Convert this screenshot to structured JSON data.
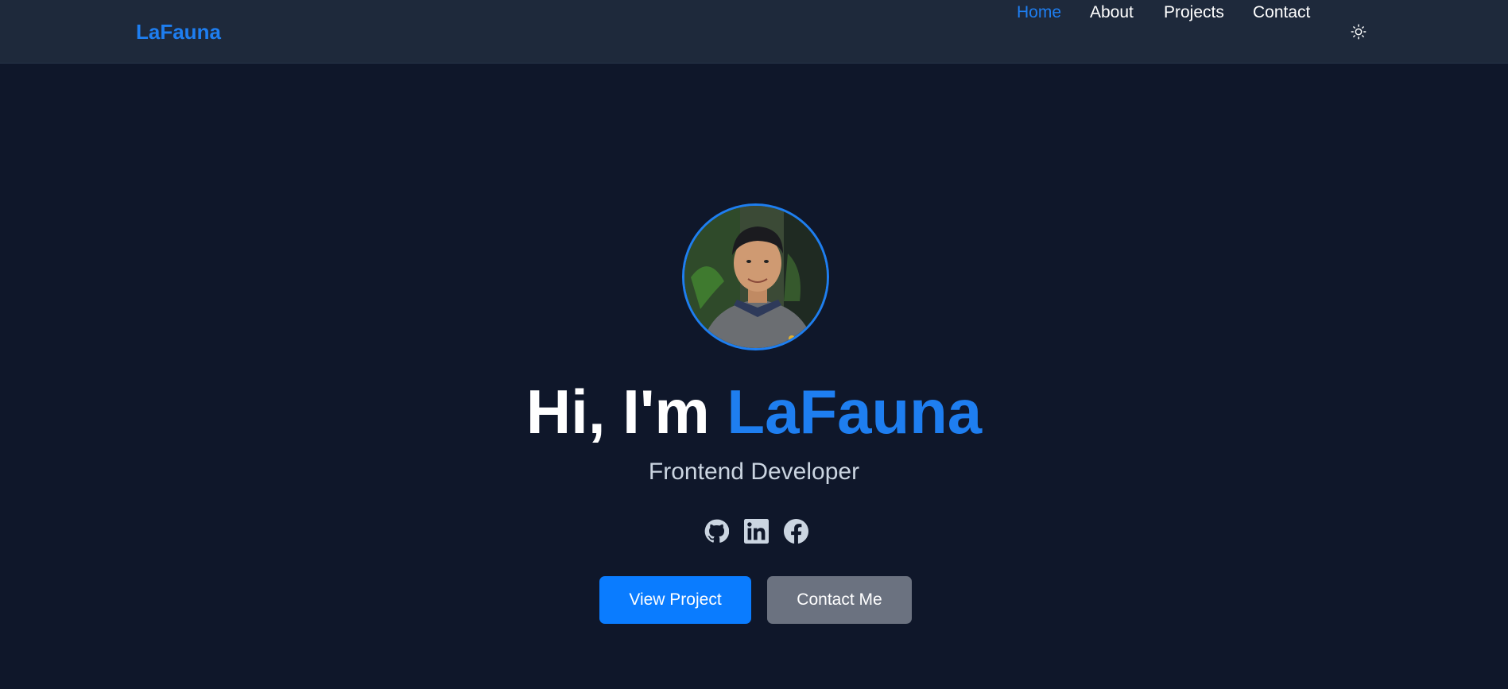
{
  "nav": {
    "brand": "LaFauna",
    "links": [
      {
        "label": "Home",
        "active": true
      },
      {
        "label": "About",
        "active": false
      },
      {
        "label": "Projects",
        "active": false
      },
      {
        "label": "Contact",
        "active": false
      }
    ],
    "theme_toggle_icon": "sun-icon"
  },
  "hero": {
    "greeting": "Hi, I'm",
    "name": "LaFauna",
    "role": "Frontend Developer",
    "socials": [
      {
        "icon": "github-icon"
      },
      {
        "icon": "linkedin-icon"
      },
      {
        "icon": "facebook-icon"
      }
    ],
    "primary_button": "View Project",
    "secondary_button": "Contact Me"
  },
  "colors": {
    "accent": "#1e7ef0",
    "background": "#0f172a",
    "navbar": "#1e293b",
    "secondary_button": "#6b7280"
  }
}
